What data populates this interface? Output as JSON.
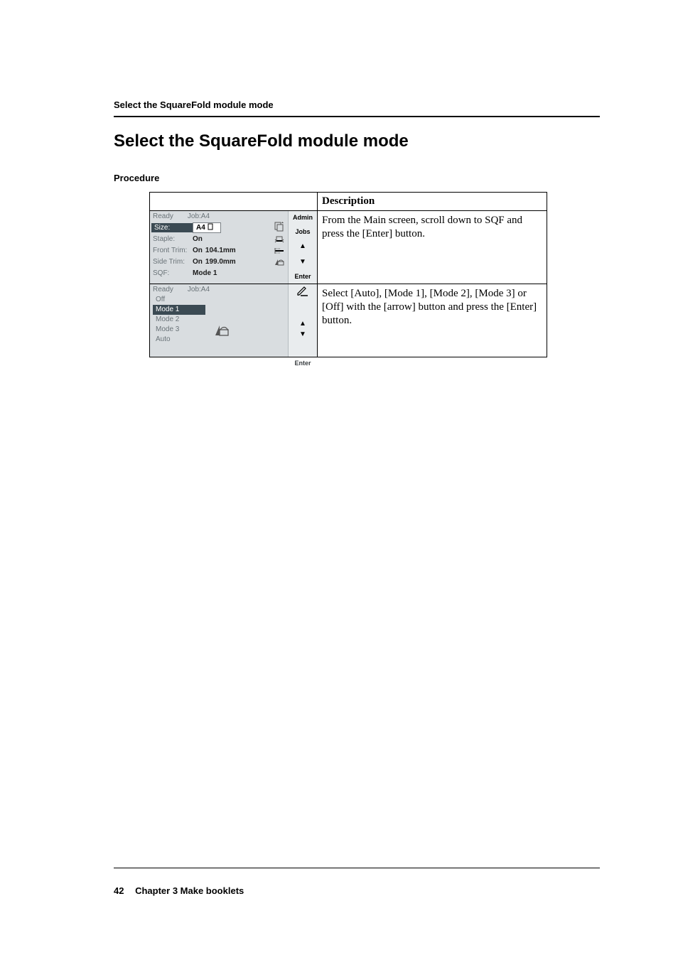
{
  "running_header": "Select the SquareFold module mode",
  "section_title": "Select the SquareFold module mode",
  "procedure_label": "Procedure",
  "table": {
    "header_col2": "Description",
    "rows": [
      {
        "description": "From the Main screen, scroll down to SQF and press the [Enter] button."
      },
      {
        "description": "Select [Auto], [Mode 1], [Mode 2], [Mode 3] or [Off] with the [arrow] button and press the [Enter] button."
      }
    ]
  },
  "lcd1": {
    "status": "Ready",
    "job_label": "Job:A4",
    "rows": {
      "size": {
        "label": "Size:",
        "value": "A4"
      },
      "staple": {
        "label": "Staple:",
        "value": "On"
      },
      "fronttrim": {
        "label": "Front Trim:",
        "on": "On",
        "value": "104.1mm"
      },
      "sidetrim": {
        "label": "Side Trim:",
        "on": "On",
        "value": "199.0mm"
      },
      "sqf": {
        "label": "SQF:",
        "value": "Mode 1"
      }
    },
    "side": {
      "admin": "Admin",
      "jobs": "Jobs",
      "up": "▲",
      "down": "▼",
      "enter": "Enter"
    }
  },
  "lcd2": {
    "status": "Ready",
    "job_label": "Job:A4",
    "options": [
      "Off",
      "Mode 1",
      "Mode 2",
      "Mode 3",
      "Auto"
    ],
    "side": {
      "up": "▲",
      "down": "▼",
      "enter": "Enter"
    }
  },
  "footer": {
    "page_number": "42",
    "chapter": "Chapter 3 Make booklets"
  },
  "icons": {
    "pencil": "edit-icon",
    "orientation": "orientation-icon",
    "front_trim": "front-trim-icon",
    "side_trim": "side-trim-icon",
    "sqf": "squarefold-icon"
  }
}
